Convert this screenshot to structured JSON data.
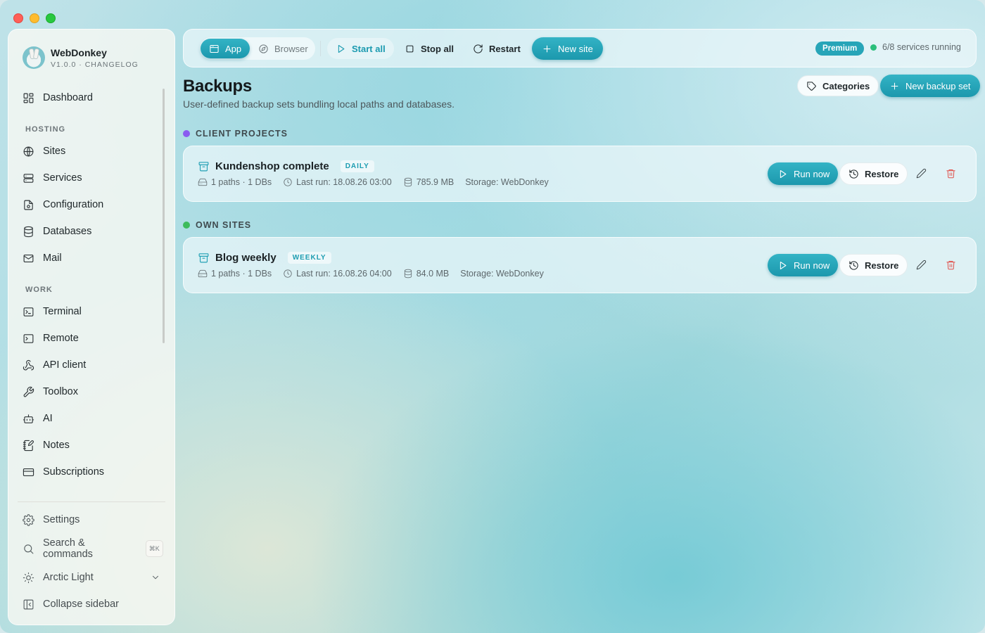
{
  "app": {
    "name": "WebDonkey",
    "version_line": "V1.0.0 · CHANGELOG"
  },
  "sidebar": {
    "dashboard": "Dashboard",
    "sections": {
      "hosting": "HOSTING",
      "work": "WORK"
    },
    "hosting_items": [
      "Sites",
      "Services",
      "Configuration",
      "Databases",
      "Mail"
    ],
    "work_items": [
      "Terminal",
      "Remote",
      "API client",
      "Toolbox",
      "AI",
      "Notes",
      "Subscriptions"
    ],
    "footer": {
      "settings": "Settings",
      "search": "Search & commands",
      "search_shortcut": "⌘K",
      "theme": "Arctic Light",
      "collapse": "Collapse sidebar"
    }
  },
  "toolbar": {
    "mode_app": "App",
    "mode_browser": "Browser",
    "start_all": "Start all",
    "stop_all": "Stop all",
    "restart": "Restart",
    "new_site": "New site",
    "plan_badge": "Premium",
    "services_status": "6/8 services running"
  },
  "page": {
    "title": "Backups",
    "subtitle": "User-defined backup sets bundling local paths and databases.",
    "categories_button": "Categories",
    "new_backup_button": "New backup set"
  },
  "groups": [
    {
      "label": "CLIENT PROJECTS",
      "color": "#8a5cf0",
      "items": [
        {
          "name": "Kundenshop complete",
          "frequency": "DAILY",
          "paths_dbs": "1 paths · 1 DBs",
          "last_run": "Last run: 18.08.26 03:00",
          "size": "785.9 MB",
          "storage": "Storage: WebDonkey",
          "run_label": "Run now",
          "restore_label": "Restore"
        }
      ]
    },
    {
      "label": "OWN SITES",
      "color": "#3dbb5c",
      "items": [
        {
          "name": "Blog weekly",
          "frequency": "WEEKLY",
          "paths_dbs": "1 paths · 1 DBs",
          "last_run": "Last run: 16.08.26 04:00",
          "size": "84.0 MB",
          "storage": "Storage: WebDonkey",
          "run_label": "Run now",
          "restore_label": "Restore"
        }
      ]
    }
  ],
  "colors": {
    "accent": "#1c98ad",
    "danger": "#e0504a",
    "status_ok": "#2bbf7b"
  }
}
